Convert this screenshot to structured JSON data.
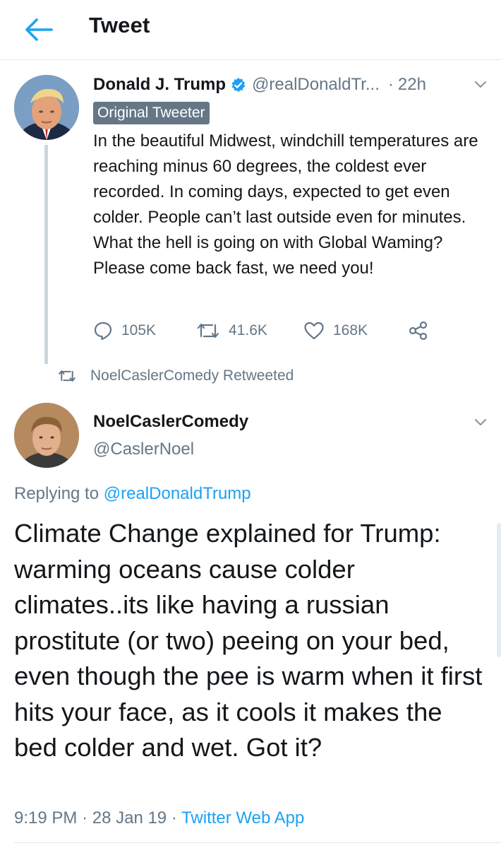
{
  "header": {
    "title": "Tweet",
    "back_icon": "arrow-left-icon"
  },
  "colors": {
    "accent": "#1da1f2",
    "muted": "#657786",
    "text": "#14171a",
    "verified": "#1da1f2"
  },
  "original_tweet": {
    "display_name": "Donald J. Trump",
    "handle": "@realDonaldTr...",
    "separator": "·",
    "time": "22h",
    "badge": "Original Tweeter",
    "text": "In the beautiful Midwest, windchill temperatures are reaching minus 60 degrees, the coldest ever recorded. In coming days, expected to get even colder. People can’t last outside even for minutes. What the hell is going on with Global Waming? Please come back fast, we need you!",
    "replies": "105K",
    "retweets": "41.6K",
    "likes": "168K"
  },
  "retweet_note": "NoelCaslerComedy Retweeted",
  "reply_tweet": {
    "display_name": "NoelCaslerComedy",
    "handle": "@CaslerNoel",
    "replying_prefix": "Replying to",
    "replying_to": "@realDonaldTrump",
    "text": "Climate Change explained for Trump: warming oceans cause colder climates..its like having a russian prostitute (or two) peeing on your bed, even though the pee is warm when it first hits your face, as it cools it makes the bed colder and wet. Got it?",
    "time": "9:19 PM",
    "sep1": "·",
    "date": "28 Jan 19",
    "sep2": "·",
    "source": "Twitter Web App"
  }
}
